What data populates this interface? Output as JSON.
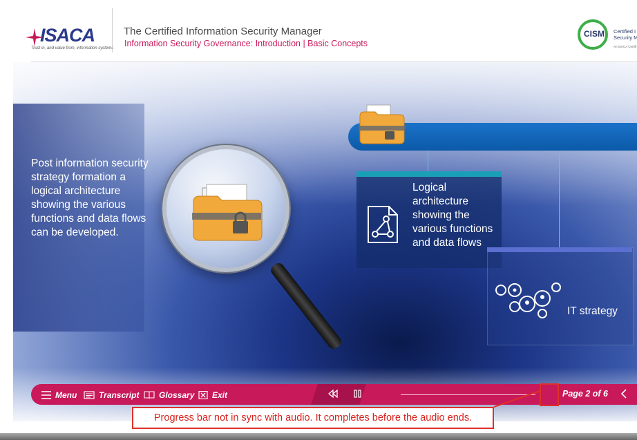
{
  "header": {
    "brand": "ISACA",
    "brand_tagline": "Trust in, and value from, information systems",
    "course_title": "The Certified Information Security Manager",
    "course_subtitle": "Information Security Governance: Introduction | Basic Concepts",
    "cert_badge": "CISM",
    "cert_side_line1": "Certified I",
    "cert_side_line2": "Security M",
    "cert_small": "An ISACA Certifi"
  },
  "slide": {
    "intro_text": "Post information security strategy formation a logical architecture showing the various functions and data flows can be developed.",
    "card1_text": "Logical architecture showing the various functions and data flows",
    "card2_text": "IT strategy"
  },
  "controls": {
    "menu_label": "Menu",
    "transcript_label": "Transcript",
    "glossary_label": "Glossary",
    "exit_label": "Exit",
    "page_indicator": "Page 2 of 6"
  },
  "annotation": {
    "note": "Progress bar not in sync with audio. It completes before the audio ends."
  },
  "colors": {
    "accent": "#c8195a",
    "annotation": "#e0302a",
    "card_top": "#1aa0b6",
    "blue_bar": "#1a72c9"
  }
}
